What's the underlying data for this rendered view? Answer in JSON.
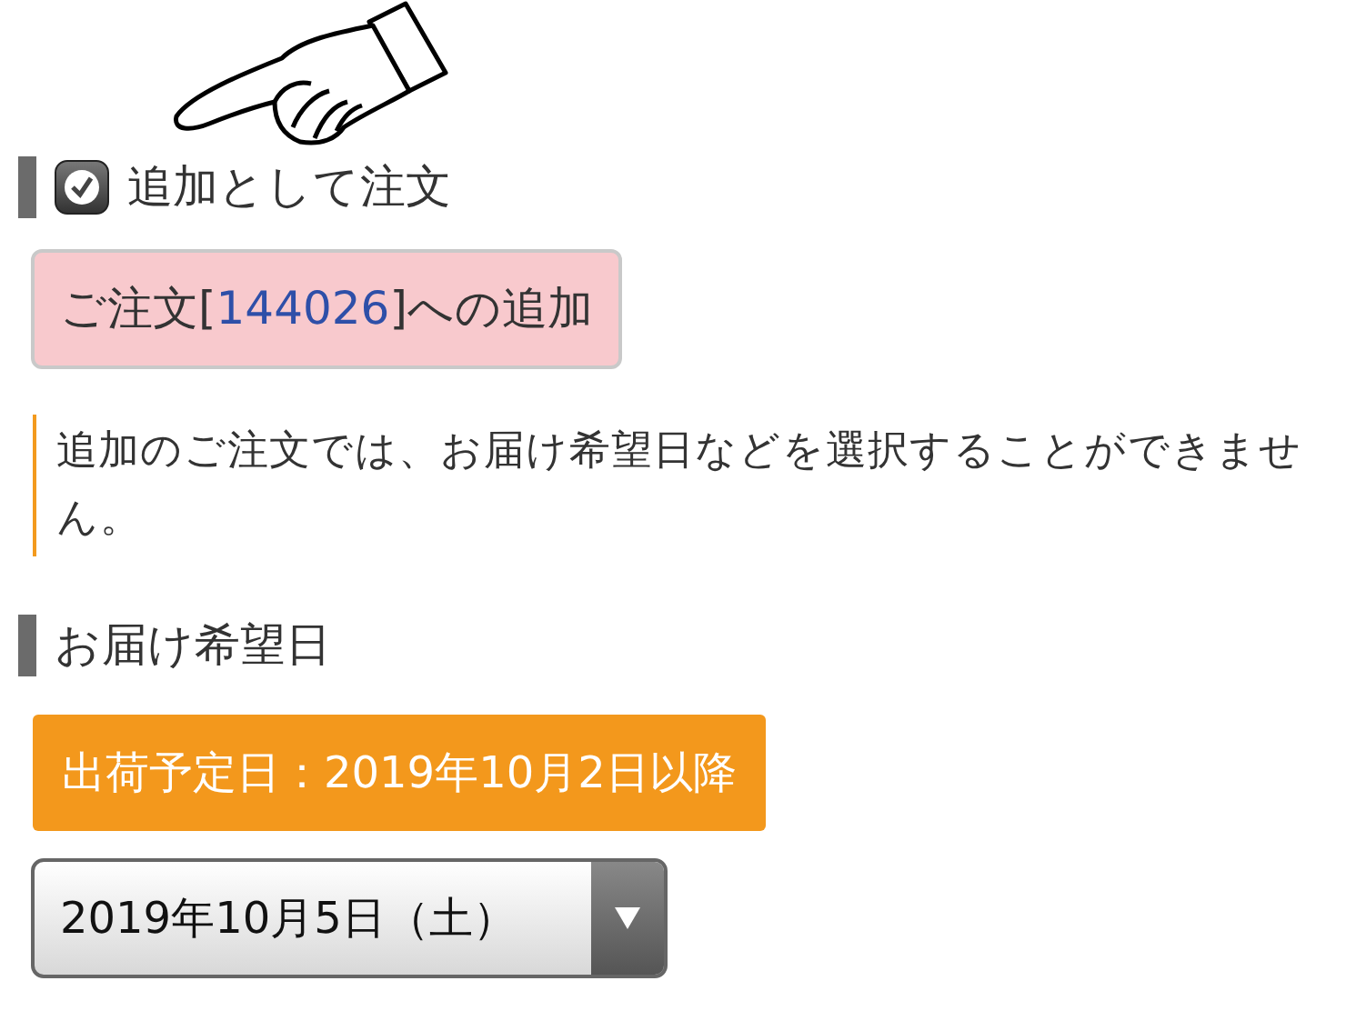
{
  "add_order_section": {
    "label": "追加として注文",
    "checked": true
  },
  "order_box": {
    "prefix": "ご注文[",
    "order_number": "144026",
    "suffix": "]への追加"
  },
  "notice": "追加のご注文では、お届け希望日などを選択することができません。",
  "delivery_section": {
    "label": "お届け希望日"
  },
  "ship_date_banner": "出荷予定日：2019年10月2日以降",
  "date_select": {
    "value": "2019年10月5日（土）"
  }
}
